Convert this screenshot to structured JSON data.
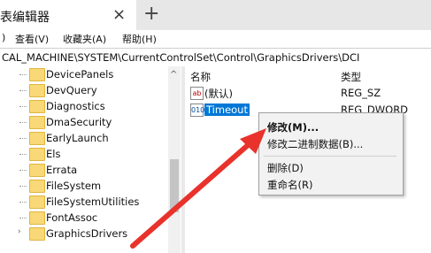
{
  "window": {
    "tab_title": "表编辑器",
    "tab_close_glyph": "×",
    "new_tab_glyph": "+"
  },
  "menubar": {
    "items": [
      ")",
      "查看(V)",
      "收藏夹(A)",
      "帮助(H)"
    ]
  },
  "address": {
    "path": "CAL_MACHINE\\SYSTEM\\CurrentControlSet\\Control\\GraphicsDrivers\\DCI"
  },
  "tree": {
    "items": [
      {
        "label": "DevicePanels"
      },
      {
        "label": "DevQuery"
      },
      {
        "label": "Diagnostics"
      },
      {
        "label": "DmaSecurity"
      },
      {
        "label": "EarlyLaunch"
      },
      {
        "label": "Els"
      },
      {
        "label": "Errata"
      },
      {
        "label": "FileSystem"
      },
      {
        "label": "FileSystemUtilities"
      },
      {
        "label": "FontAssoc"
      },
      {
        "label": "GraphicsDrivers"
      }
    ]
  },
  "list": {
    "columns": {
      "name": "名称",
      "type": "类型"
    },
    "rows": [
      {
        "icon": "ab",
        "name": "(默认)",
        "type": "REG_SZ"
      },
      {
        "icon": "010",
        "name": "Timeout",
        "type": "REG_DWORD"
      }
    ]
  },
  "context_menu": {
    "modify": "修改(M)...",
    "modify_binary": "修改二进制数据(B)...",
    "delete": "删除(D)",
    "rename": "重命名(R)"
  },
  "colors": {
    "selection": "#0078d7",
    "arrow": "#e8322b"
  }
}
